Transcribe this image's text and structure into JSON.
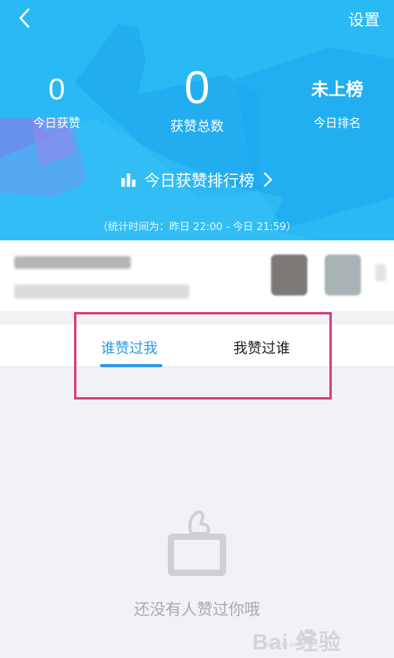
{
  "topbar": {
    "back_icon": "chevron-left-icon",
    "settings_label": "设置"
  },
  "stats": {
    "today_likes": {
      "value": "0",
      "label": "今日获赞"
    },
    "total_likes": {
      "value": "0",
      "label": "获赞总数"
    },
    "today_rank": {
      "value": "未上榜",
      "label": "今日排名"
    }
  },
  "rank_link": {
    "label": "今日获赞排行榜",
    "icon": "bar-chart-icon",
    "arrow_icon": "chevron-right-icon"
  },
  "time_note": "（统计时间为：昨日 22:00 - 今日 21:59）",
  "tabs": [
    {
      "label": "谁赞过我",
      "active": true
    },
    {
      "label": "我赞过谁",
      "active": false
    }
  ],
  "empty_state": {
    "icon": "thumbs-up-icon",
    "text": "还没有人赞过你哦"
  },
  "watermark": {
    "logo_text": "Bai 经验",
    "url": "jingyan.baidu.com"
  },
  "colors": {
    "header_bg": "#29b9f4",
    "accent": "#2c9be6",
    "highlight_border": "#d83c7a",
    "page_bg": "#f2f2f6"
  }
}
